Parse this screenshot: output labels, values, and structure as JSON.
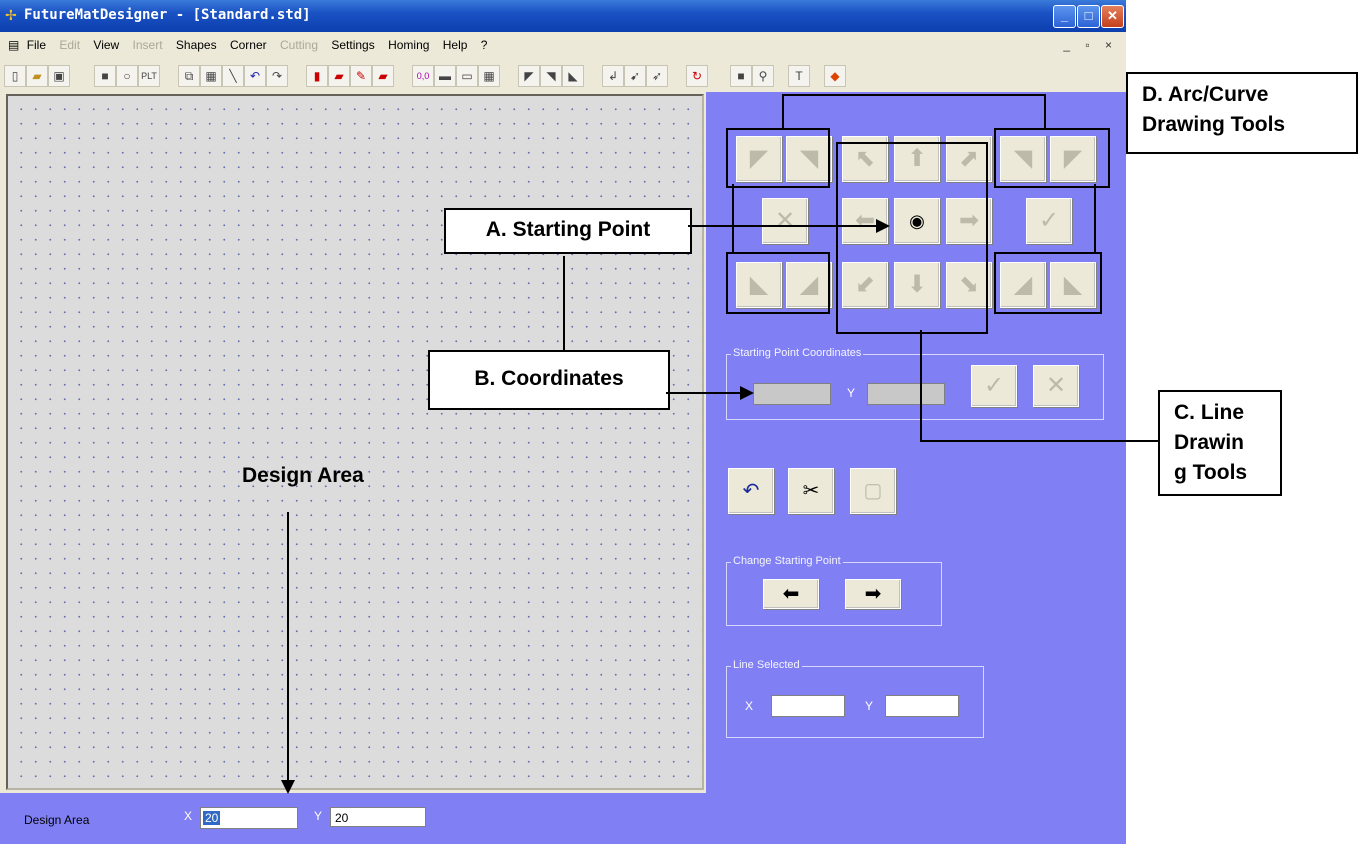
{
  "window": {
    "title": "FutureMatDesigner - [Standard.std]",
    "minimize": "_",
    "maximize": "□",
    "close": "✕"
  },
  "menu": {
    "items": [
      {
        "label": "File",
        "enabled": true
      },
      {
        "label": "Edit",
        "enabled": false
      },
      {
        "label": "View",
        "enabled": true
      },
      {
        "label": "Insert",
        "enabled": false
      },
      {
        "label": "Shapes",
        "enabled": true
      },
      {
        "label": "Corner",
        "enabled": true
      },
      {
        "label": "Cutting",
        "enabled": false
      },
      {
        "label": "Settings",
        "enabled": true
      },
      {
        "label": "Homing",
        "enabled": true
      },
      {
        "label": "Help",
        "enabled": true
      },
      {
        "label": "?",
        "enabled": true
      }
    ],
    "mdi_controls": "_ ▫ ×"
  },
  "toolbar": {
    "icons": [
      "new-icon",
      "open-icon",
      "save-icon",
      "rectangle-icon",
      "circle-icon",
      "plt-icon",
      "copy-icon",
      "paste-icon",
      "line-icon",
      "undo-icon",
      "redo-icon",
      "import-icon",
      "folder-icon",
      "edit-icon",
      "export-icon",
      "origin-icon",
      "align-left-icon",
      "align-center-icon",
      "grid-icon",
      "corner1-icon",
      "corner2-icon",
      "corner3-icon",
      "arrow1-icon",
      "arrow2-icon",
      "arrow3-icon",
      "refresh-icon",
      "page-icon",
      "wrench-icon",
      "text-icon",
      "color-icon"
    ],
    "plt": "PLT",
    "origin": "0,0"
  },
  "line_tools": {
    "center": "◉",
    "cancel": "✕",
    "ok": "✓"
  },
  "coordinates_group": {
    "title": "Starting Point Coordinates",
    "x_value": "",
    "y_label": "Y",
    "y_value": ""
  },
  "edit_tools": {
    "undo": "↶",
    "cut": "✂"
  },
  "change_start_group": {
    "title": "Change Starting Point",
    "left": "⬅",
    "right": "➡"
  },
  "line_selected_group": {
    "title": "Line Selected",
    "x_label": "X",
    "x_value": "",
    "y_label": "Y",
    "y_value": ""
  },
  "status_bar": {
    "label": "Design Area",
    "x_label": "X",
    "x_value": "20",
    "y_label": "Y",
    "y_value": "20"
  },
  "callouts": {
    "starting_point": "A. Starting Point",
    "coordinates": "B. Coordinates",
    "line_tools_1": "C. Line",
    "line_tools_2": "Drawin",
    "line_tools_3": "g Tools",
    "arc_tools_1": "D. Arc/Curve",
    "arc_tools_2": "Drawing Tools",
    "design_area": "Design Area"
  }
}
